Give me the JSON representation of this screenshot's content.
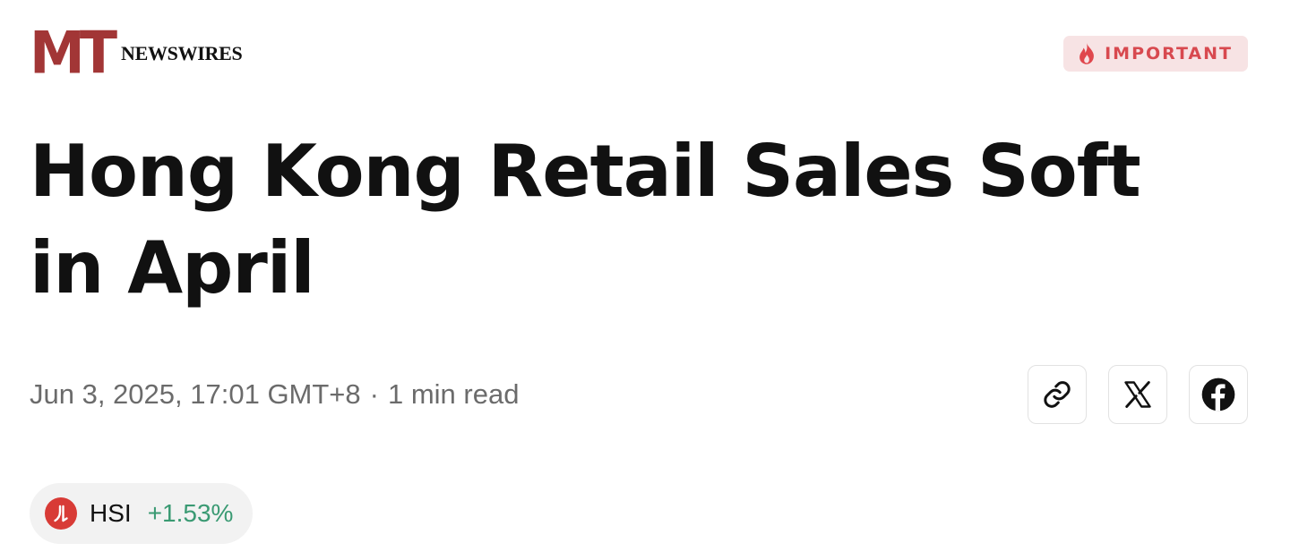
{
  "brand": {
    "logo_mark": "MT",
    "logo_text": "NEWSWIRES",
    "logo_color": "#a23636"
  },
  "badge": {
    "label": "IMPORTANT",
    "icon": "flame-icon",
    "text_color": "#d8494f",
    "background": "#f7e3e4"
  },
  "article": {
    "headline": "Hong Kong Retail Sales Soft in April",
    "date": "Jun 3, 2025, 17:01 GMT+8",
    "separator": "·",
    "read_time": "1 min read"
  },
  "share": {
    "buttons": [
      {
        "name": "copy-link",
        "icon": "link-icon"
      },
      {
        "name": "share-x",
        "icon": "x-icon"
      },
      {
        "name": "share-facebook",
        "icon": "facebook-icon"
      }
    ]
  },
  "ticker": {
    "symbol": "HSI",
    "change": "+1.53%",
    "change_color": "#3a9a73",
    "logo_color": "#d83b36"
  }
}
